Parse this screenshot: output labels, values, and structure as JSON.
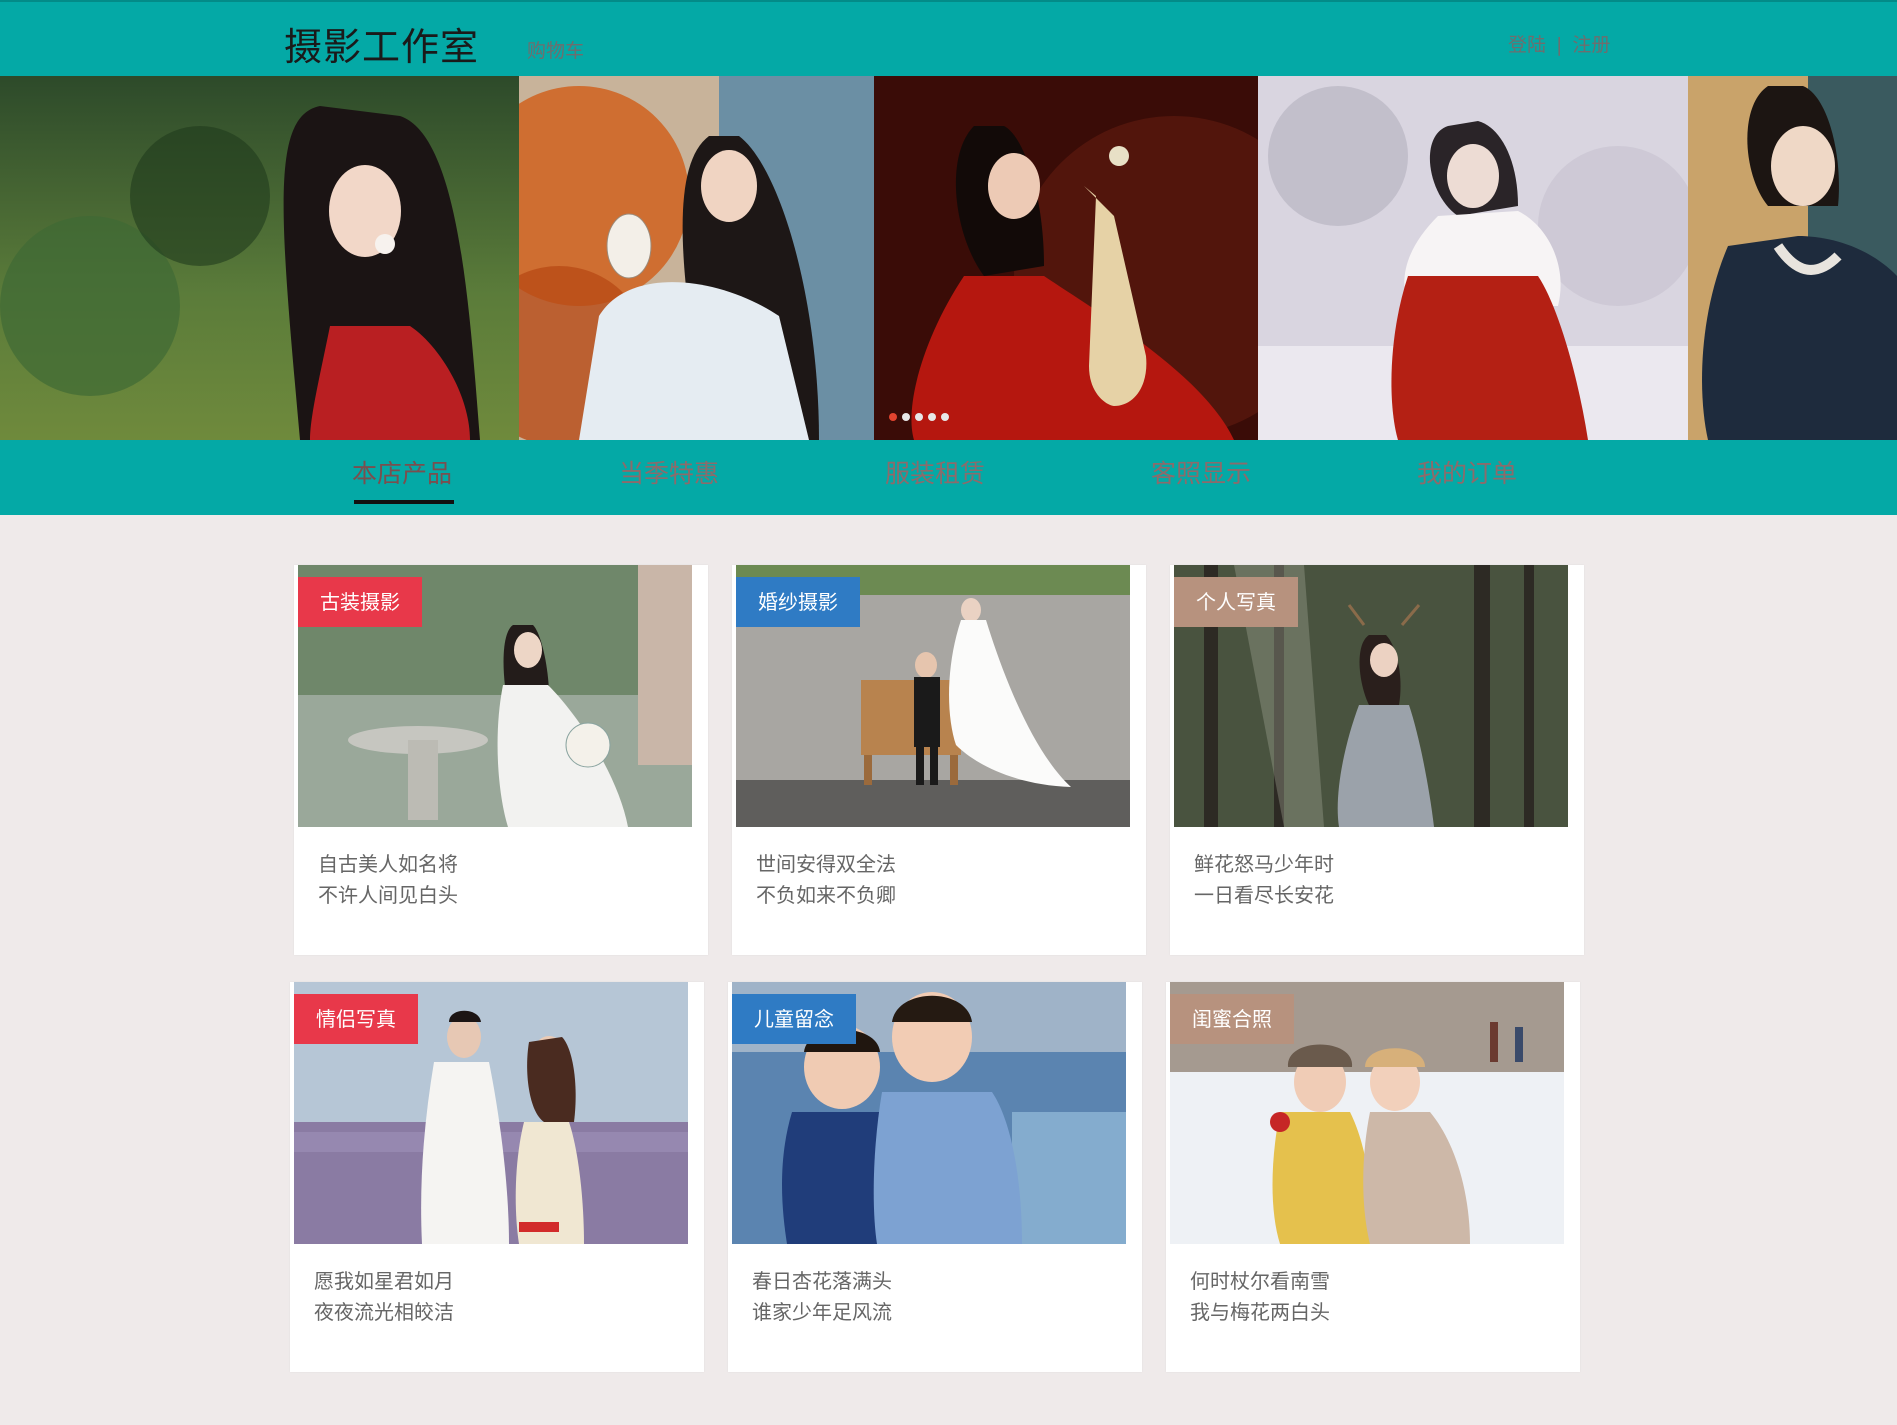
{
  "header": {
    "brand": "摄影工作室",
    "cart": "购物车",
    "login": "登陆",
    "separator": "|",
    "register": "注册"
  },
  "banner": {
    "slide_count": 5,
    "active_index": 0
  },
  "category_nav": {
    "items": [
      "本店产品",
      "当季特惠",
      "服装租赁",
      "客照显示",
      "我的订单"
    ],
    "active_index": 0
  },
  "products": [
    {
      "tag": "古装摄影",
      "tag_color": "#e8384a",
      "line1": "自古美人如名将",
      "line2": "不许人间见白头"
    },
    {
      "tag": "婚纱摄影",
      "tag_color": "#2f7bc4",
      "line1": "世间安得双全法",
      "line2": "不负如来不负卿"
    },
    {
      "tag": "个人写真",
      "tag_color": "#b7927e",
      "line1": "鲜花怒马少年时",
      "line2": "一日看尽长安花"
    },
    {
      "tag": "情侣写真",
      "tag_color": "#e8384a",
      "line1": "愿我如星君如月",
      "line2": "夜夜流光相皎洁"
    },
    {
      "tag": "儿童留念",
      "tag_color": "#2f7bc4",
      "line1": "春日杏花落满头",
      "line2": "谁家少年足风流"
    },
    {
      "tag": "闺蜜合照",
      "tag_color": "#b7927e",
      "line1": "何时杖尔看南雪",
      "line2": "我与梅花两白头"
    }
  ],
  "colors": {
    "header_bg": "#04a9a6",
    "page_bg": "#efeaea",
    "nav_text": "#8c6b6b"
  }
}
